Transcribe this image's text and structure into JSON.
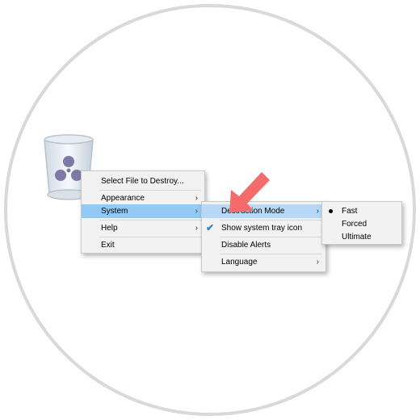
{
  "colors": {
    "circle_border": "#d9d9d9",
    "menu_background": "#f2f2f2",
    "highlight": "#91c9f7",
    "pointer_arrow": "#f26c6c"
  },
  "icons": {
    "app": "shredder-recycle-bin-icon",
    "pointer": "red-arrow-icon",
    "check": "check-icon",
    "bullet": "radio-bullet-icon",
    "submenu_arrow": "chevron-right-icon"
  },
  "main_menu": {
    "select_file": "Select File to Destroy...",
    "appearance": "Appearance",
    "system": "System",
    "help": "Help",
    "exit": "Exit"
  },
  "system_menu": {
    "destruction_mode": "Destruction Mode",
    "show_tray_icon": "Show system tray icon",
    "show_tray_icon_checked": true,
    "disable_alerts": "Disable Alerts",
    "language": "Language"
  },
  "destruction_mode_menu": {
    "fast": "Fast",
    "forced": "Forced",
    "ultimate": "Ultimate",
    "selected": "Fast"
  },
  "glyphs": {
    "submenu_arrow": "›",
    "check": "✔"
  }
}
